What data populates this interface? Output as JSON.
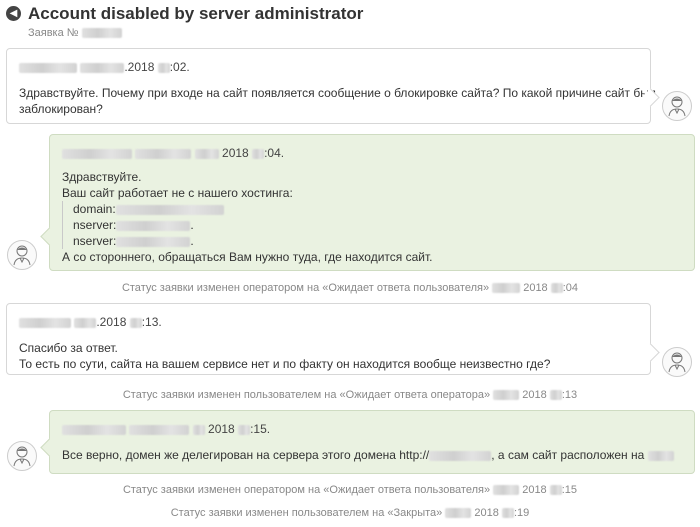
{
  "header": {
    "back_icon": "arrow-left-icon",
    "title": "Account disabled by server administrator",
    "ticket_label": "Заявка №"
  },
  "messages": [
    {
      "role": "user",
      "date_suffix": ".2018",
      "time_suffix": ":02.",
      "lines": [
        "Здравствуйте. Почему при входе на сайт появляется сообщение о блокировке сайта? По какой причине сайт был",
        "заблокирован?"
      ]
    },
    {
      "role": "operator",
      "date_suffix": "2018",
      "time_suffix": ":04.",
      "greeting": "Здравствуйте.",
      "intro": "Ваш сайт работает не с нашего хостинга:",
      "domain_label": "domain:",
      "nserver1_label": "nserver:",
      "nserver2_label": "nserver:",
      "dot": ".",
      "outro": "А со стороннего, обращаться Вам нужно туда, где находится сайт."
    },
    {
      "role": "user",
      "date_suffix": ".2018",
      "time_suffix": ":13.",
      "lines": [
        "Спасибо за ответ.",
        "То есть по сути, сайта на вашем сервисе нет и по факту он находится вообще неизвестно где?"
      ]
    },
    {
      "role": "operator",
      "date_suffix": "2018",
      "time_suffix": ":15.",
      "text_part1": "Все верно, домен же делегирован на сервера этого домена http://",
      "text_part2": ", а сам сайт расположен на"
    }
  ],
  "status_changes": [
    {
      "text": "Статус заявки изменен оператором на «Ожидает ответа пользователя»",
      "year": "2018",
      "time_suffix": ":04"
    },
    {
      "text": "Статус заявки изменен пользователем на «Ожидает ответа оператора»",
      "year": "2018",
      "time_suffix": ":13"
    },
    {
      "text": "Статус заявки изменен оператором на «Ожидает ответа пользователя»",
      "year": "2018",
      "time_suffix": ":15"
    },
    {
      "text": "Статус заявки изменен пользователем на «Закрыта»",
      "year": "2018",
      "time_suffix": ":19"
    }
  ],
  "avatar_icon": "user-avatar-icon",
  "colors": {
    "operator_bg": "#eaf2e1",
    "user_bg": "#ffffff",
    "status_text": "#888888"
  }
}
